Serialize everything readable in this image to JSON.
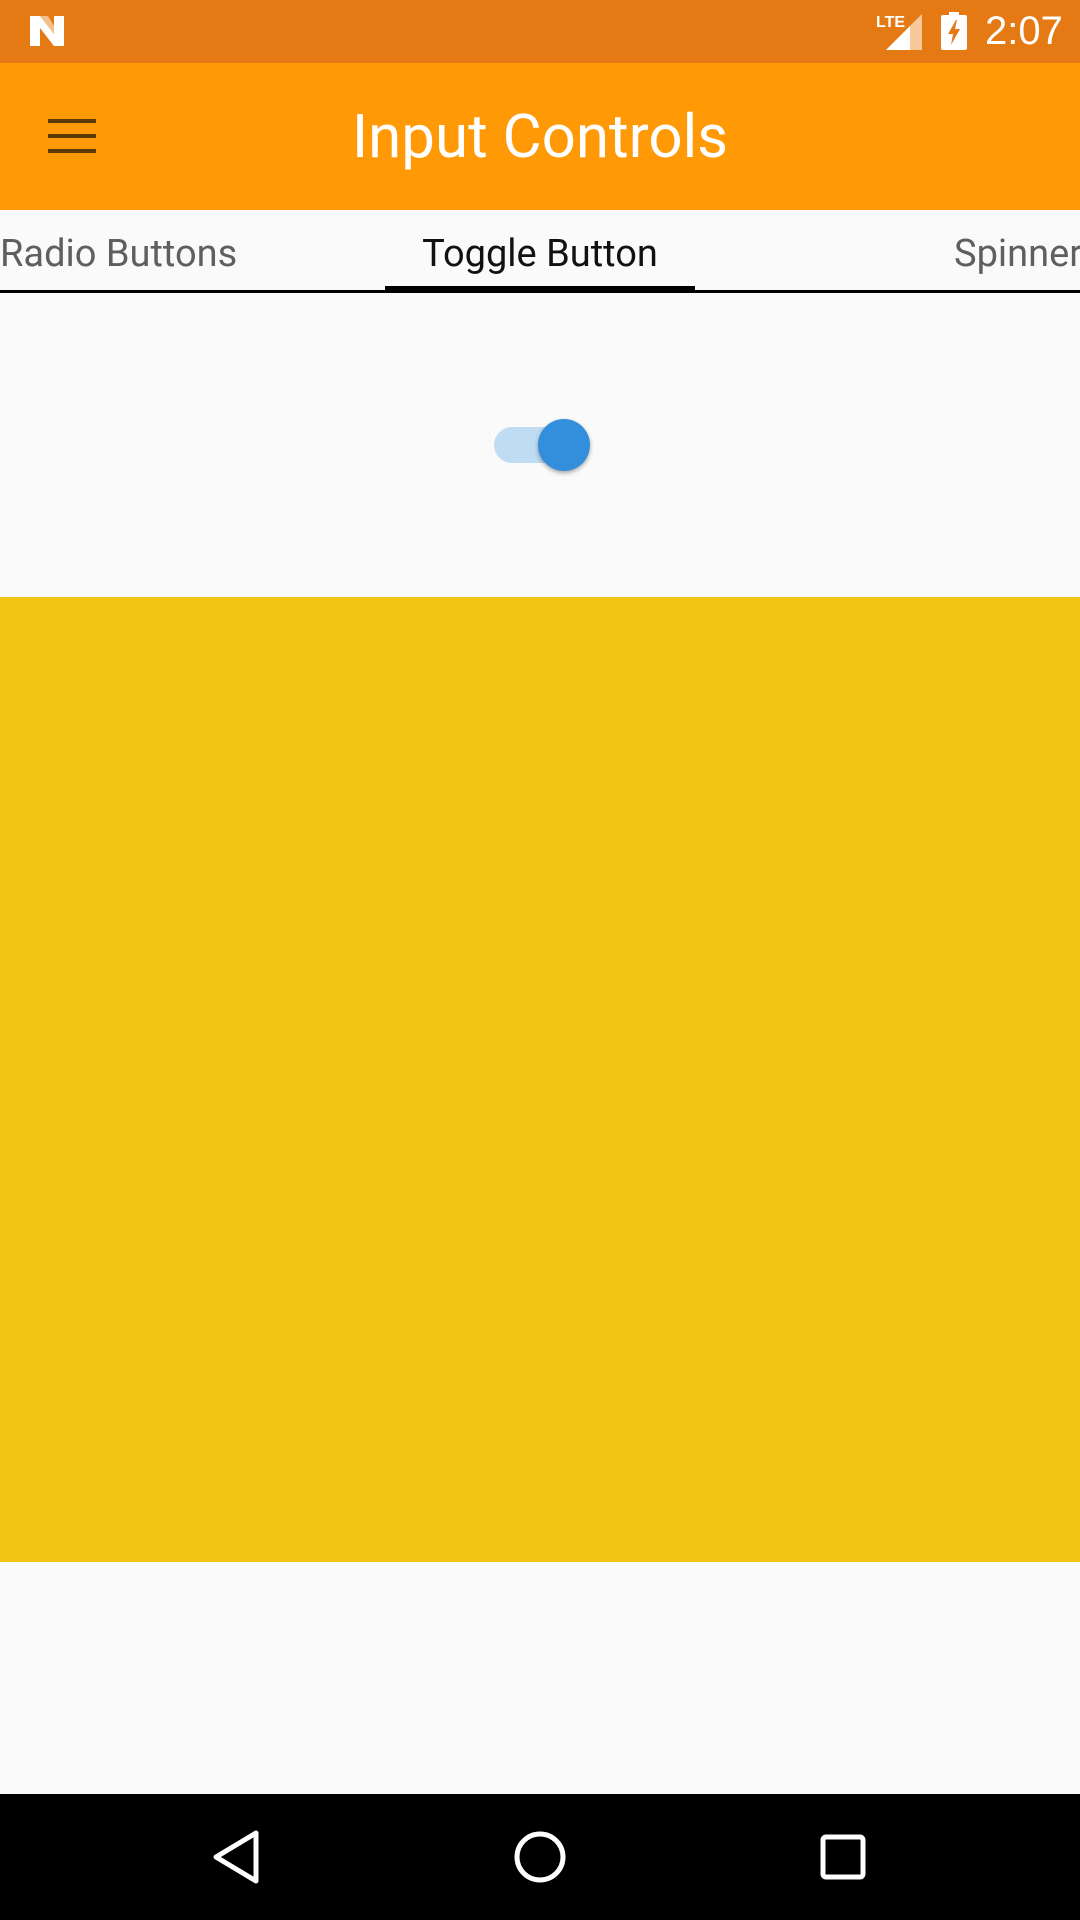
{
  "status_bar": {
    "time": "2:07",
    "network_label": "LTE",
    "icons": [
      "notification-n-icon",
      "lte-signal-icon",
      "battery-charging-icon"
    ]
  },
  "app_bar": {
    "title": "Input Controls",
    "menu_icon": "hamburger-menu-icon"
  },
  "tabs": [
    {
      "label": "Radio Buttons",
      "selected": false
    },
    {
      "label": "Toggle Button",
      "selected": true
    },
    {
      "label": "Spinner",
      "selected": false
    }
  ],
  "toggle": {
    "checked": true,
    "track_color": "#bfdcf2",
    "thumb_color": "#338fdb"
  },
  "color_panel": {
    "color": "#f0c413"
  },
  "nav_bar": {
    "buttons": [
      "back-icon",
      "home-icon",
      "recents-icon"
    ]
  },
  "colors": {
    "status_bar": "#e57a15",
    "app_bar": "#ff9905",
    "background": "#fafafa"
  }
}
